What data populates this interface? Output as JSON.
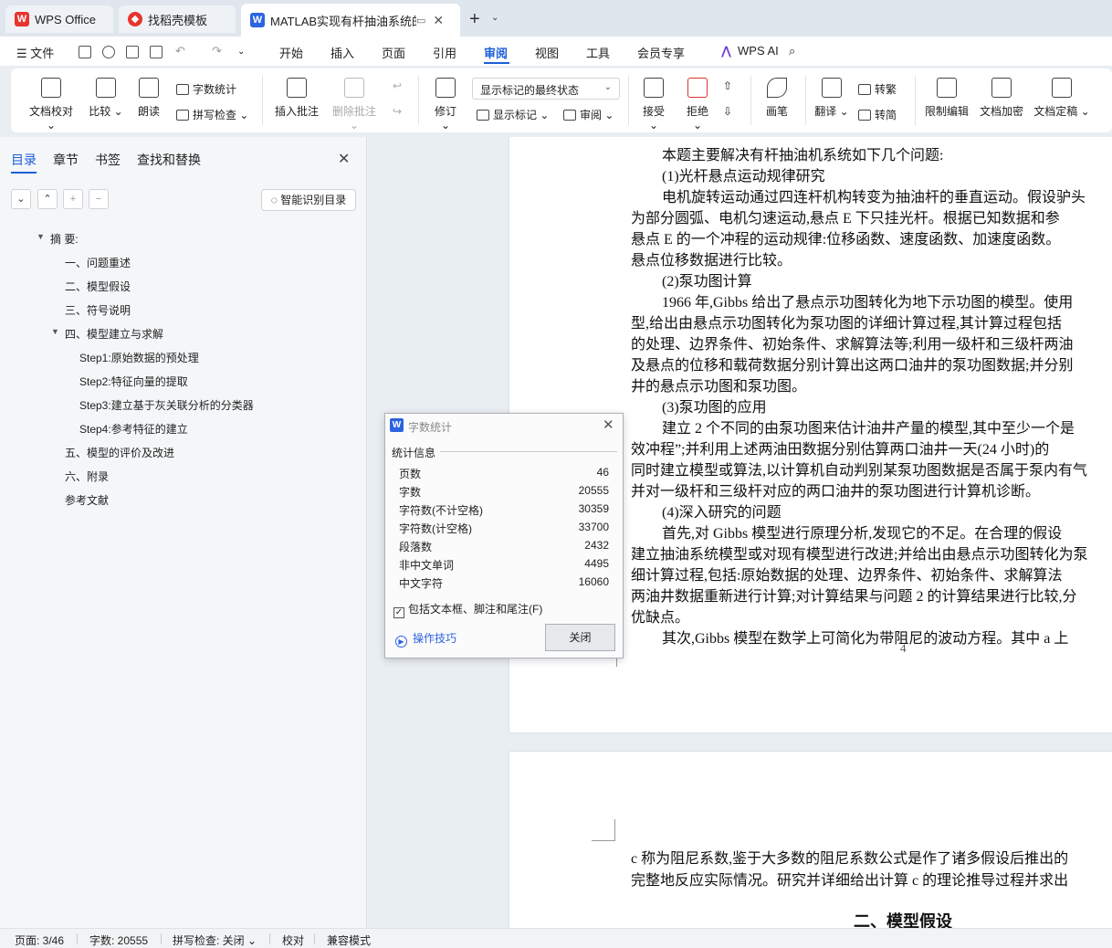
{
  "tabs": [
    {
      "label": "WPS Office"
    },
    {
      "label": "找稻壳模板"
    },
    {
      "label": "MATLAB实现有杆抽油系统的"
    }
  ],
  "menu": {
    "file": "文件",
    "items": [
      "开始",
      "插入",
      "页面",
      "引用",
      "审阅",
      "视图",
      "工具",
      "会员专享"
    ],
    "active": "审阅",
    "wps_ai": "WPS AI"
  },
  "ribbon": {
    "doc_check": "文档校对",
    "compare": "比较",
    "read_aloud": "朗读",
    "word_count": "字数统计",
    "spell_check": "拼写检查",
    "insert_comment": "插入批注",
    "delete_comment": "删除批注",
    "revise": "修订",
    "markup_select": "显示标记的最终状态",
    "show_markup": "显示标记",
    "review": "审阅",
    "accept": "接受",
    "reject": "拒绝",
    "pen": "画笔",
    "translate": "翻译",
    "to_traditional": "转繁",
    "to_simplified": "转简",
    "restrict_edit": "限制编辑",
    "encrypt": "文档加密",
    "finalize": "文档定稿"
  },
  "nav": {
    "tabs": [
      "目录",
      "章节",
      "书签",
      "查找和替换"
    ],
    "smart_toc": "智能识别目录",
    "toc": [
      {
        "label": "摘 要:"
      },
      {
        "label": "一、问题重述"
      },
      {
        "label": "二、模型假设"
      },
      {
        "label": "三、符号说明"
      },
      {
        "label": "四、模型建立与求解"
      },
      {
        "label": "Step1:原始数据的预处理"
      },
      {
        "label": "Step2:特征向量的提取"
      },
      {
        "label": "Step3:建立基于灰关联分析的分类器"
      },
      {
        "label": "Step4:参考特征的建立"
      },
      {
        "label": "五、模型的评价及改进"
      },
      {
        "label": "六、附录"
      },
      {
        "label": "参考文献"
      }
    ]
  },
  "document": {
    "page1_lines": [
      "本题主要解决有杆抽油机系统如下几个问题:",
      "(1)光杆悬点运动规律研究",
      "电机旋转运动通过四连杆机构转变为抽油杆的垂直运动。假设驴头",
      "为部分圆弧、电机匀速运动,悬点 E 下只挂光杆。根据已知数据和参",
      "悬点 E 的一个冲程的运动规律:位移函数、速度函数、加速度函数。",
      "悬点位移数据进行比较。",
      "(2)泵功图计算",
      "1966 年,Gibbs 给出了悬点示功图转化为地下示功图的模型。使用",
      "型,给出由悬点示功图转化为泵功图的详细计算过程,其计算过程包括",
      "的处理、边界条件、初始条件、求解算法等;利用一级杆和三级杆两油",
      "及悬点的位移和载荷数据分别计算出这两口油井的泵功图数据;并分别",
      "井的悬点示功图和泵功图。",
      "(3)泵功图的应用",
      "建立 2 个不同的由泵功图来估计油井产量的模型,其中至少一个是",
      "效冲程”;并利用上述两油田数据分别估算两口油井一天(24 小时)的",
      "同时建立模型或算法,以计算机自动判别某泵功图数据是否属于泵内有气",
      "并对一级杆和三级杆对应的两口油井的泵功图进行计算机诊断。",
      "(4)深入研究的问题",
      "首先,对 Gibbs 模型进行原理分析,发现它的不足。在合理的假设",
      "建立抽油系统模型或对现有模型进行改进;并给出由悬点示功图转化为泵",
      "细计算过程,包括:原始数据的处理、边界条件、初始条件、求解算法",
      "两油井数据重新进行计算;对计算结果与问题 2 的计算结果进行比较,分",
      "优缺点。",
      "其次,Gibbs 模型在数学上可简化为带阻尼的波动方程。其中 a 上"
    ],
    "page_number": "4",
    "page2_lines": [
      "c 称为阻尼系数,鉴于大多数的阻尼系数公式是作了诸多假设后推出的",
      "完整地反应实际情况。研究并详细给出计算 c 的理论推导过程并求出"
    ],
    "page2_heading": "二、模型假设"
  },
  "dialog": {
    "title": "字数统计",
    "group": "统计信息",
    "stats": [
      {
        "label": "页数",
        "value": "46"
      },
      {
        "label": "字数",
        "value": "20555"
      },
      {
        "label": "字符数(不计空格)",
        "value": "30359"
      },
      {
        "label": "字符数(计空格)",
        "value": "33700"
      },
      {
        "label": "段落数",
        "value": "2432"
      },
      {
        "label": "非中文单词",
        "value": "4495"
      },
      {
        "label": "中文字符",
        "value": "16060"
      }
    ],
    "include_label": "包括文本框、脚注和尾注(F)",
    "tips": "操作技巧",
    "close": "关闭"
  },
  "status": {
    "page": "页面: 3/46",
    "words": "字数: 20555",
    "spell": "拼写检查: 关闭",
    "proof": "校对",
    "compat": "兼容模式"
  },
  "colors": {
    "accent": "#1a5fd8",
    "wps_red": "#e8342e",
    "doc_blue": "#2b63e0"
  }
}
